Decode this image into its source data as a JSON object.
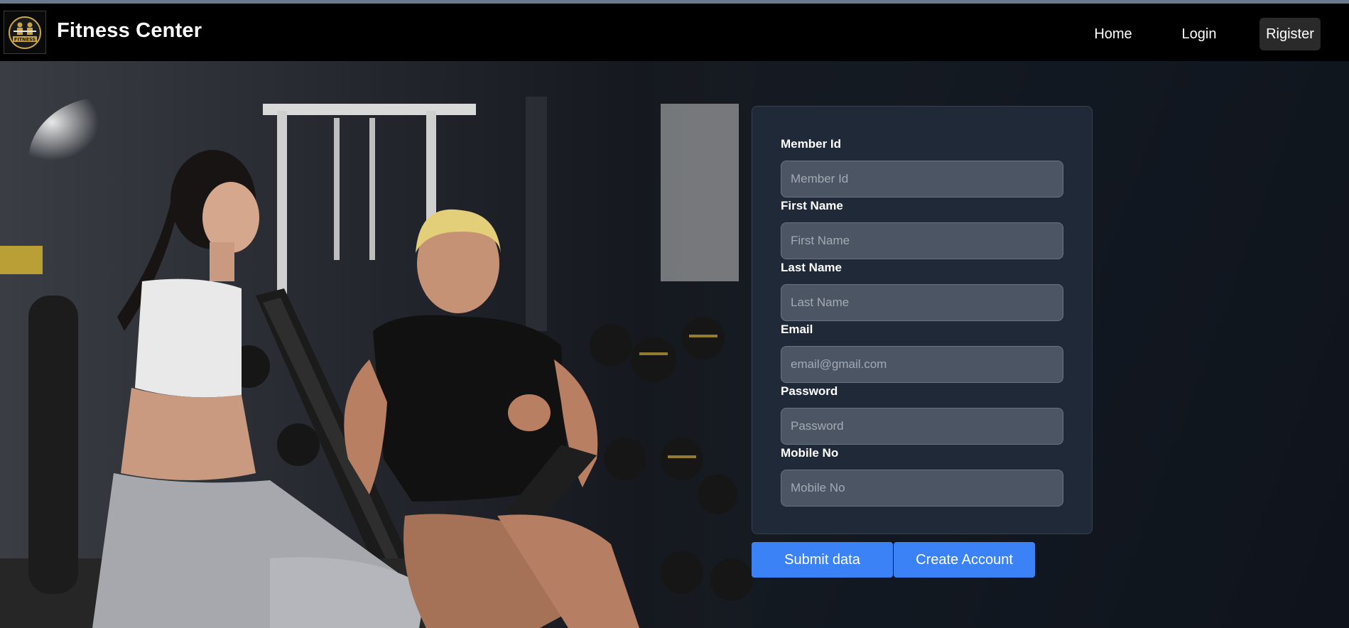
{
  "brand": {
    "name": "Fitness Center",
    "logo_icon": "fitness-logo-icon",
    "logo_text": "FITNESS"
  },
  "nav": {
    "home": "Home",
    "login": "Login",
    "register": "Rigister"
  },
  "form": {
    "fields": [
      {
        "label": "Member Id",
        "placeholder": "Member Id",
        "value": ""
      },
      {
        "label": "First Name",
        "placeholder": "First Name",
        "value": ""
      },
      {
        "label": "Last Name",
        "placeholder": "Last Name",
        "value": ""
      },
      {
        "label": "Email",
        "placeholder": "email@gmail.com",
        "value": ""
      },
      {
        "label": "Password",
        "placeholder": "Password",
        "value": ""
      },
      {
        "label": "Mobile No",
        "placeholder": "Mobile No",
        "value": ""
      }
    ],
    "submit_label": "Submit data",
    "create_label": "Create Account"
  },
  "colors": {
    "navbar": "#000000",
    "card": "#1f2937",
    "input": "#4b5563",
    "button": "#3b82f6"
  }
}
